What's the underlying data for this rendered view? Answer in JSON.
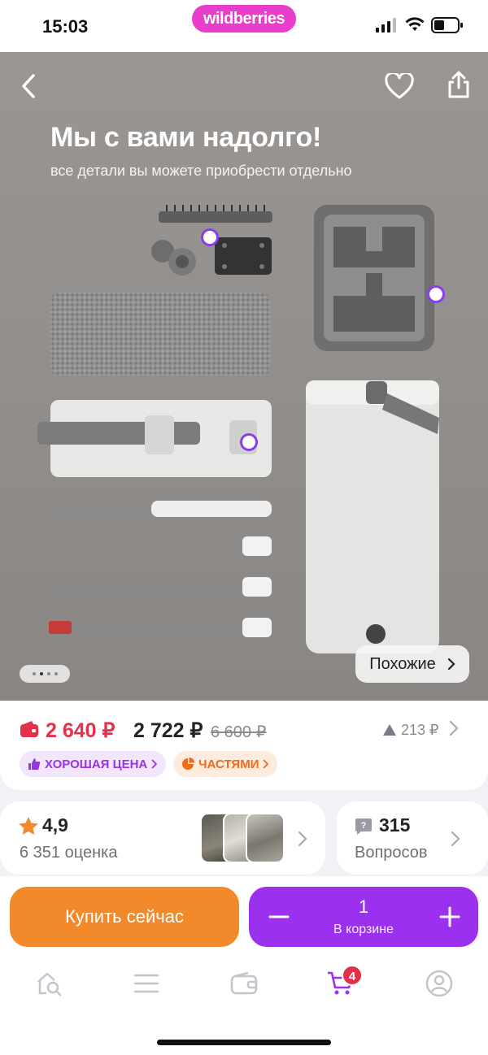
{
  "status": {
    "time": "15:03",
    "brand": "wildberries"
  },
  "hero": {
    "title": "Мы с вами надолго!",
    "subtitle": "все детали вы можете приобрести отдельно",
    "similar_label": "Похожие",
    "pager": {
      "count": 4,
      "active": 2
    }
  },
  "price": {
    "wallet_price": "2 640 ₽",
    "price": "2 722 ₽",
    "old_price": "6 600 ₽",
    "drop": "213 ₽",
    "badges": [
      {
        "label": "ХОРОШАЯ ЦЕНА"
      },
      {
        "label": "ЧАСТЯМИ"
      }
    ]
  },
  "rating": {
    "value": "4,9",
    "count": "6 351 оценка"
  },
  "questions": {
    "value": "315",
    "label": "Вопросов"
  },
  "actions": {
    "buy_label": "Купить сейчас",
    "qty": "1",
    "qty_label": "В корзине"
  },
  "tabbar": {
    "cart_count": "4"
  },
  "colors": {
    "accent": "#9b31ee",
    "buy": "#f28a2c",
    "wallet": "#e5304c",
    "brand": "#e93dcc"
  }
}
